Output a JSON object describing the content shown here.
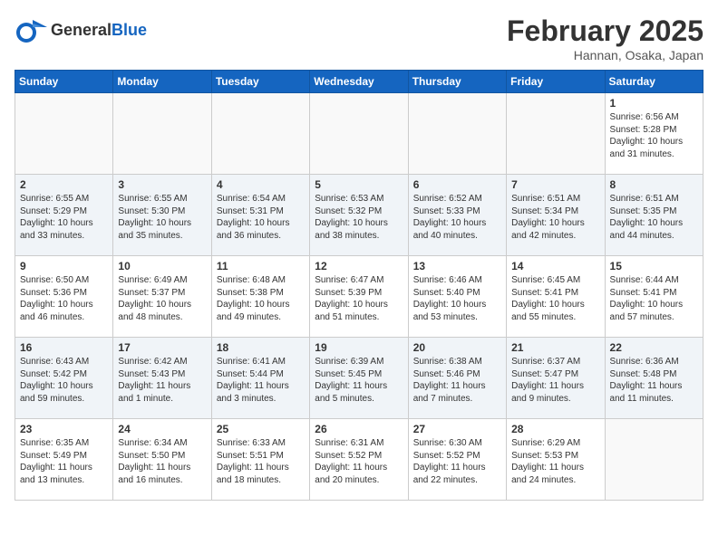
{
  "header": {
    "logo_line1": "General",
    "logo_line2": "Blue",
    "title": "February 2025",
    "subtitle": "Hannan, Osaka, Japan"
  },
  "days_of_week": [
    "Sunday",
    "Monday",
    "Tuesday",
    "Wednesday",
    "Thursday",
    "Friday",
    "Saturday"
  ],
  "weeks": [
    [
      {
        "day": "",
        "info": ""
      },
      {
        "day": "",
        "info": ""
      },
      {
        "day": "",
        "info": ""
      },
      {
        "day": "",
        "info": ""
      },
      {
        "day": "",
        "info": ""
      },
      {
        "day": "",
        "info": ""
      },
      {
        "day": "1",
        "info": "Sunrise: 6:56 AM\nSunset: 5:28 PM\nDaylight: 10 hours and 31 minutes."
      }
    ],
    [
      {
        "day": "2",
        "info": "Sunrise: 6:55 AM\nSunset: 5:29 PM\nDaylight: 10 hours and 33 minutes."
      },
      {
        "day": "3",
        "info": "Sunrise: 6:55 AM\nSunset: 5:30 PM\nDaylight: 10 hours and 35 minutes."
      },
      {
        "day": "4",
        "info": "Sunrise: 6:54 AM\nSunset: 5:31 PM\nDaylight: 10 hours and 36 minutes."
      },
      {
        "day": "5",
        "info": "Sunrise: 6:53 AM\nSunset: 5:32 PM\nDaylight: 10 hours and 38 minutes."
      },
      {
        "day": "6",
        "info": "Sunrise: 6:52 AM\nSunset: 5:33 PM\nDaylight: 10 hours and 40 minutes."
      },
      {
        "day": "7",
        "info": "Sunrise: 6:51 AM\nSunset: 5:34 PM\nDaylight: 10 hours and 42 minutes."
      },
      {
        "day": "8",
        "info": "Sunrise: 6:51 AM\nSunset: 5:35 PM\nDaylight: 10 hours and 44 minutes."
      }
    ],
    [
      {
        "day": "9",
        "info": "Sunrise: 6:50 AM\nSunset: 5:36 PM\nDaylight: 10 hours and 46 minutes."
      },
      {
        "day": "10",
        "info": "Sunrise: 6:49 AM\nSunset: 5:37 PM\nDaylight: 10 hours and 48 minutes."
      },
      {
        "day": "11",
        "info": "Sunrise: 6:48 AM\nSunset: 5:38 PM\nDaylight: 10 hours and 49 minutes."
      },
      {
        "day": "12",
        "info": "Sunrise: 6:47 AM\nSunset: 5:39 PM\nDaylight: 10 hours and 51 minutes."
      },
      {
        "day": "13",
        "info": "Sunrise: 6:46 AM\nSunset: 5:40 PM\nDaylight: 10 hours and 53 minutes."
      },
      {
        "day": "14",
        "info": "Sunrise: 6:45 AM\nSunset: 5:41 PM\nDaylight: 10 hours and 55 minutes."
      },
      {
        "day": "15",
        "info": "Sunrise: 6:44 AM\nSunset: 5:41 PM\nDaylight: 10 hours and 57 minutes."
      }
    ],
    [
      {
        "day": "16",
        "info": "Sunrise: 6:43 AM\nSunset: 5:42 PM\nDaylight: 10 hours and 59 minutes."
      },
      {
        "day": "17",
        "info": "Sunrise: 6:42 AM\nSunset: 5:43 PM\nDaylight: 11 hours and 1 minute."
      },
      {
        "day": "18",
        "info": "Sunrise: 6:41 AM\nSunset: 5:44 PM\nDaylight: 11 hours and 3 minutes."
      },
      {
        "day": "19",
        "info": "Sunrise: 6:39 AM\nSunset: 5:45 PM\nDaylight: 11 hours and 5 minutes."
      },
      {
        "day": "20",
        "info": "Sunrise: 6:38 AM\nSunset: 5:46 PM\nDaylight: 11 hours and 7 minutes."
      },
      {
        "day": "21",
        "info": "Sunrise: 6:37 AM\nSunset: 5:47 PM\nDaylight: 11 hours and 9 minutes."
      },
      {
        "day": "22",
        "info": "Sunrise: 6:36 AM\nSunset: 5:48 PM\nDaylight: 11 hours and 11 minutes."
      }
    ],
    [
      {
        "day": "23",
        "info": "Sunrise: 6:35 AM\nSunset: 5:49 PM\nDaylight: 11 hours and 13 minutes."
      },
      {
        "day": "24",
        "info": "Sunrise: 6:34 AM\nSunset: 5:50 PM\nDaylight: 11 hours and 16 minutes."
      },
      {
        "day": "25",
        "info": "Sunrise: 6:33 AM\nSunset: 5:51 PM\nDaylight: 11 hours and 18 minutes."
      },
      {
        "day": "26",
        "info": "Sunrise: 6:31 AM\nSunset: 5:52 PM\nDaylight: 11 hours and 20 minutes."
      },
      {
        "day": "27",
        "info": "Sunrise: 6:30 AM\nSunset: 5:52 PM\nDaylight: 11 hours and 22 minutes."
      },
      {
        "day": "28",
        "info": "Sunrise: 6:29 AM\nSunset: 5:53 PM\nDaylight: 11 hours and 24 minutes."
      },
      {
        "day": "",
        "info": ""
      }
    ]
  ]
}
